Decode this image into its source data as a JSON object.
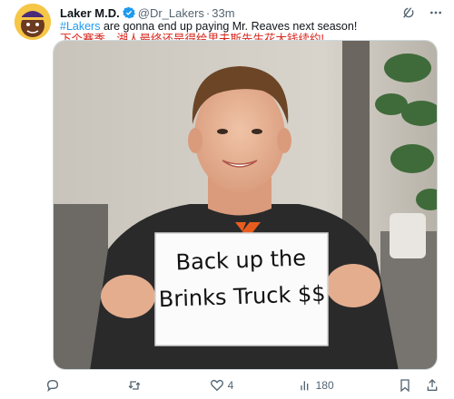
{
  "author": {
    "name": "Laker M.D.",
    "handle": "@Dr_Lakers",
    "separator": "·",
    "time": "33m"
  },
  "text": {
    "hashtag": "#Lakers",
    "line1_rest": " are gonna end up paying Mr. Reaves next season!",
    "line2": "下个赛季，湖人最终还是得给里夫斯先生花大钱续约!"
  },
  "media": {
    "sign_line1": "Back up the",
    "sign_line2": "Brinks Truck $$"
  },
  "actions": {
    "replies": "",
    "reposts": "",
    "likes": "4",
    "views": "180"
  },
  "colors": {
    "accent": "#1d9bf0",
    "chinese_text": "#d7261d",
    "muted": "#536471"
  }
}
